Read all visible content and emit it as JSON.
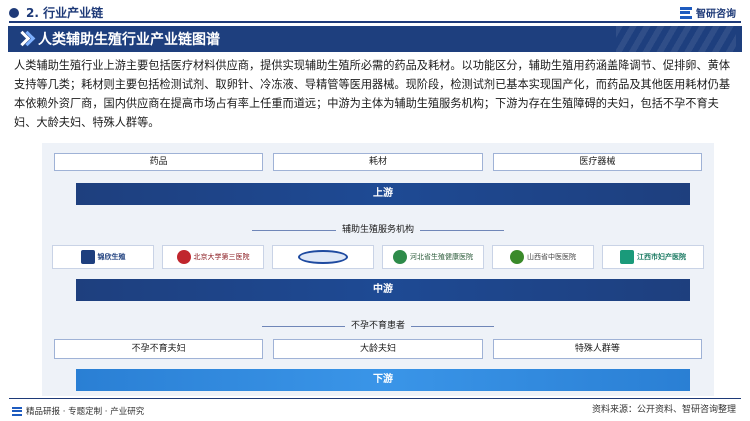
{
  "header": {
    "section_title": "2. 行业产业链",
    "brand": "智研咨询"
  },
  "banner": {
    "title": "人类辅助生殖行业产业链图谱"
  },
  "intro": "人类辅助生殖行业上游主要包括医疗材料供应商，提供实现辅助生殖所必需的药品及耗材。以功能区分，辅助生殖用药涵盖降调节、促排卵、黄体支持等几类；耗材则主要包括检测试剂、取卵针、冷冻液、导精管等医用器械。现阶段，检测试剂已基本实现国产化，而药品及其他医用耗材仍基本依赖外资厂商，国内供应商在提高市场占有率上任重而道远；中游为主体为辅助生殖服务机构；下游为存在生殖障碍的夫妇，包括不孕不育夫妇、大龄夫妇、特殊人群等。",
  "diagram": {
    "upstream": {
      "items": [
        "药品",
        "耗材",
        "医疗器械"
      ],
      "label": "上游"
    },
    "midstream": {
      "sub_label": "辅助生殖服务机构",
      "logos": [
        {
          "text": "锦欣生殖"
        },
        {
          "text": "北京大学第三医院"
        },
        {
          "text": ""
        },
        {
          "text": "河北省生殖健康医院"
        },
        {
          "text": "山西省中医医院"
        },
        {
          "text": "江西市妇产医院"
        }
      ],
      "label": "中游"
    },
    "downstream": {
      "sub_label": "不孕不育患者",
      "items": [
        "不孕不育夫妇",
        "大龄夫妇",
        "特殊人群等"
      ],
      "label": "下游"
    }
  },
  "footer": {
    "left": "精品研报 · 专题定制 · 产业研究",
    "source": "资料来源：公开资料、智研咨询整理"
  },
  "colors": {
    "navy": "#1e3f7e",
    "downstream_blue": "#2a7fd4",
    "panel_bg": "#eef2f8"
  }
}
